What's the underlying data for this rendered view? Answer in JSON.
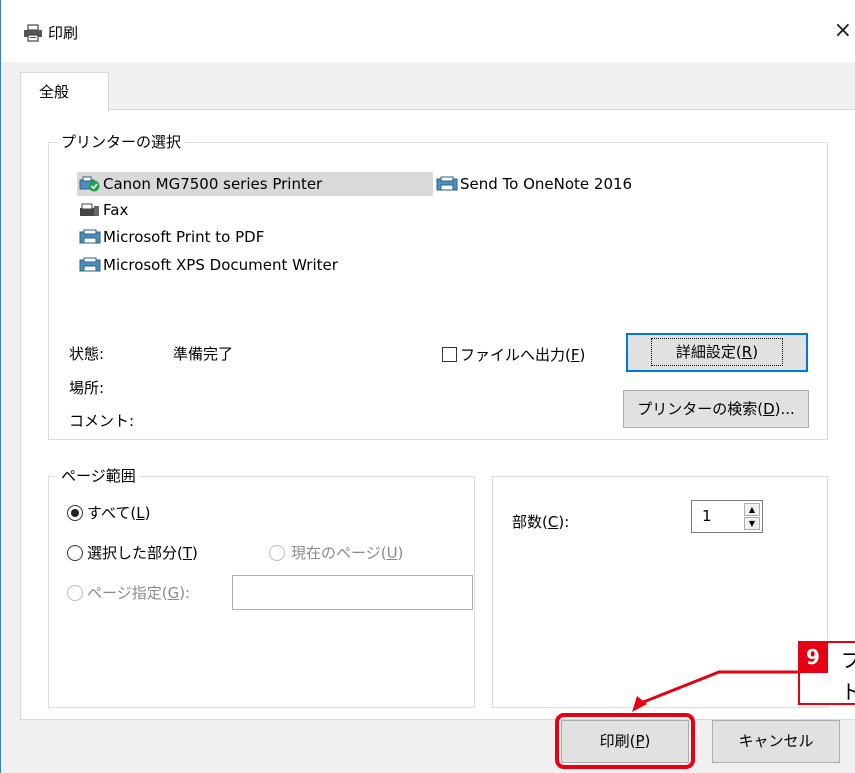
{
  "window": {
    "title": "印刷",
    "close_glyph": "×"
  },
  "tabs": [
    {
      "label": "全般"
    }
  ],
  "printer_group": {
    "label": "プリンターの選択",
    "printers": [
      {
        "name": "Canon MG7500 series Printer",
        "selected": true,
        "default": true
      },
      {
        "name": "Send To OneNote 2016"
      },
      {
        "name": "Fax"
      },
      {
        "name": "Microsoft Print to PDF"
      },
      {
        "name": "Microsoft XPS Document Writer"
      }
    ],
    "status_label": "状態:",
    "status_value": "準備完了",
    "location_label": "場所:",
    "comment_label": "コメント:",
    "print_to_file_prefix": "ファイルへ出力(",
    "print_to_file_key": "F",
    "print_to_file_suffix": ")",
    "preferences_prefix": "詳細設定(",
    "preferences_key": "R",
    "preferences_suffix": ")",
    "find_printer_prefix": "プリンターの検索(",
    "find_printer_key": "D",
    "find_printer_suffix": ")..."
  },
  "page_range_group": {
    "label": "ページ範囲",
    "all_prefix": "すべて(",
    "all_key": "L",
    "all_suffix": ")",
    "selection_prefix": "選択した部分(",
    "selection_key": "T",
    "selection_suffix": ")",
    "current_page_prefix": "現在のページ(",
    "current_page_key": "U",
    "current_page_suffix": ")",
    "pages_prefix": "ページ指定(",
    "pages_key": "G",
    "pages_suffix": "):"
  },
  "copies": {
    "label_prefix": "部数(",
    "label_key": "C",
    "label_suffix": "):",
    "value": "1"
  },
  "buttons": {
    "print_prefix": "印刷(",
    "print_key": "P",
    "print_suffix": ")",
    "cancel": "キャンセル"
  },
  "annotation": {
    "number": "9",
    "line1": "プ",
    "line2": "ト",
    "color": "#e60012"
  },
  "colors": {
    "accent": "#0078d7",
    "selection": "#d9d9d9",
    "annotation_red": "#e60012"
  }
}
